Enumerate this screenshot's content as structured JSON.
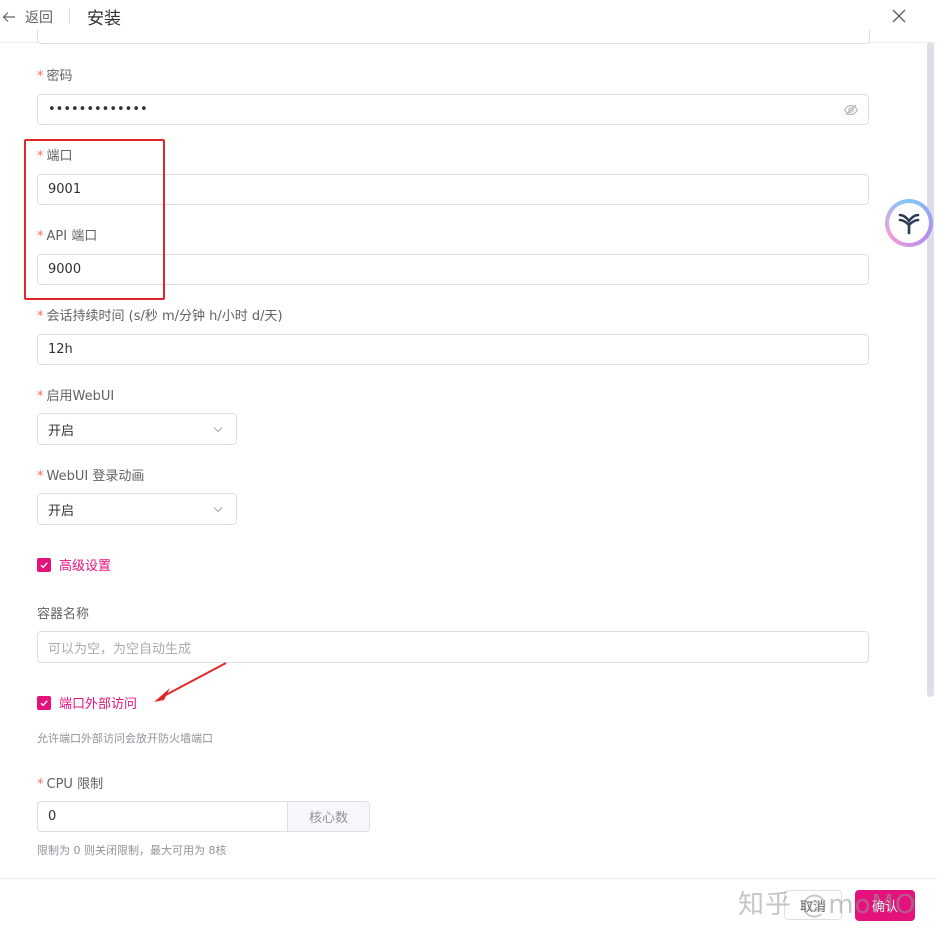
{
  "header": {
    "back_label": "返回",
    "title": "安装"
  },
  "form": {
    "password": {
      "label": "密码",
      "value": "•••••••••••••"
    },
    "port": {
      "label": "端口",
      "value": "9001"
    },
    "api_port": {
      "label": "API 端口",
      "value": "9000"
    },
    "session": {
      "label": "会话持续时间 (s/秒 m/分钟 h/小时 d/天)",
      "value": "12h"
    },
    "webui": {
      "label": "启用WebUI",
      "value": "开启"
    },
    "webui_anim": {
      "label": "WebUI 登录动画",
      "value": "开启"
    },
    "advanced": {
      "label": "高级设置",
      "checked": true
    },
    "container": {
      "label": "容器名称",
      "placeholder": "可以为空，为空自动生成"
    },
    "external": {
      "label": "端口外部访问",
      "checked": true,
      "hint": "允许端口外部访问会放开防火墙端口"
    },
    "cpu": {
      "label": "CPU 限制",
      "value": "0",
      "append": "核心数",
      "hint": "限制为 0 则关闭限制，最大可用为 8核"
    }
  },
  "footer": {
    "cancel_label": "取消",
    "confirm_label": "确认"
  },
  "watermark": "知乎 @moMO",
  "colors": {
    "accent": "#e5127d",
    "annotation": "#e02828",
    "required": "#f56c6c"
  }
}
